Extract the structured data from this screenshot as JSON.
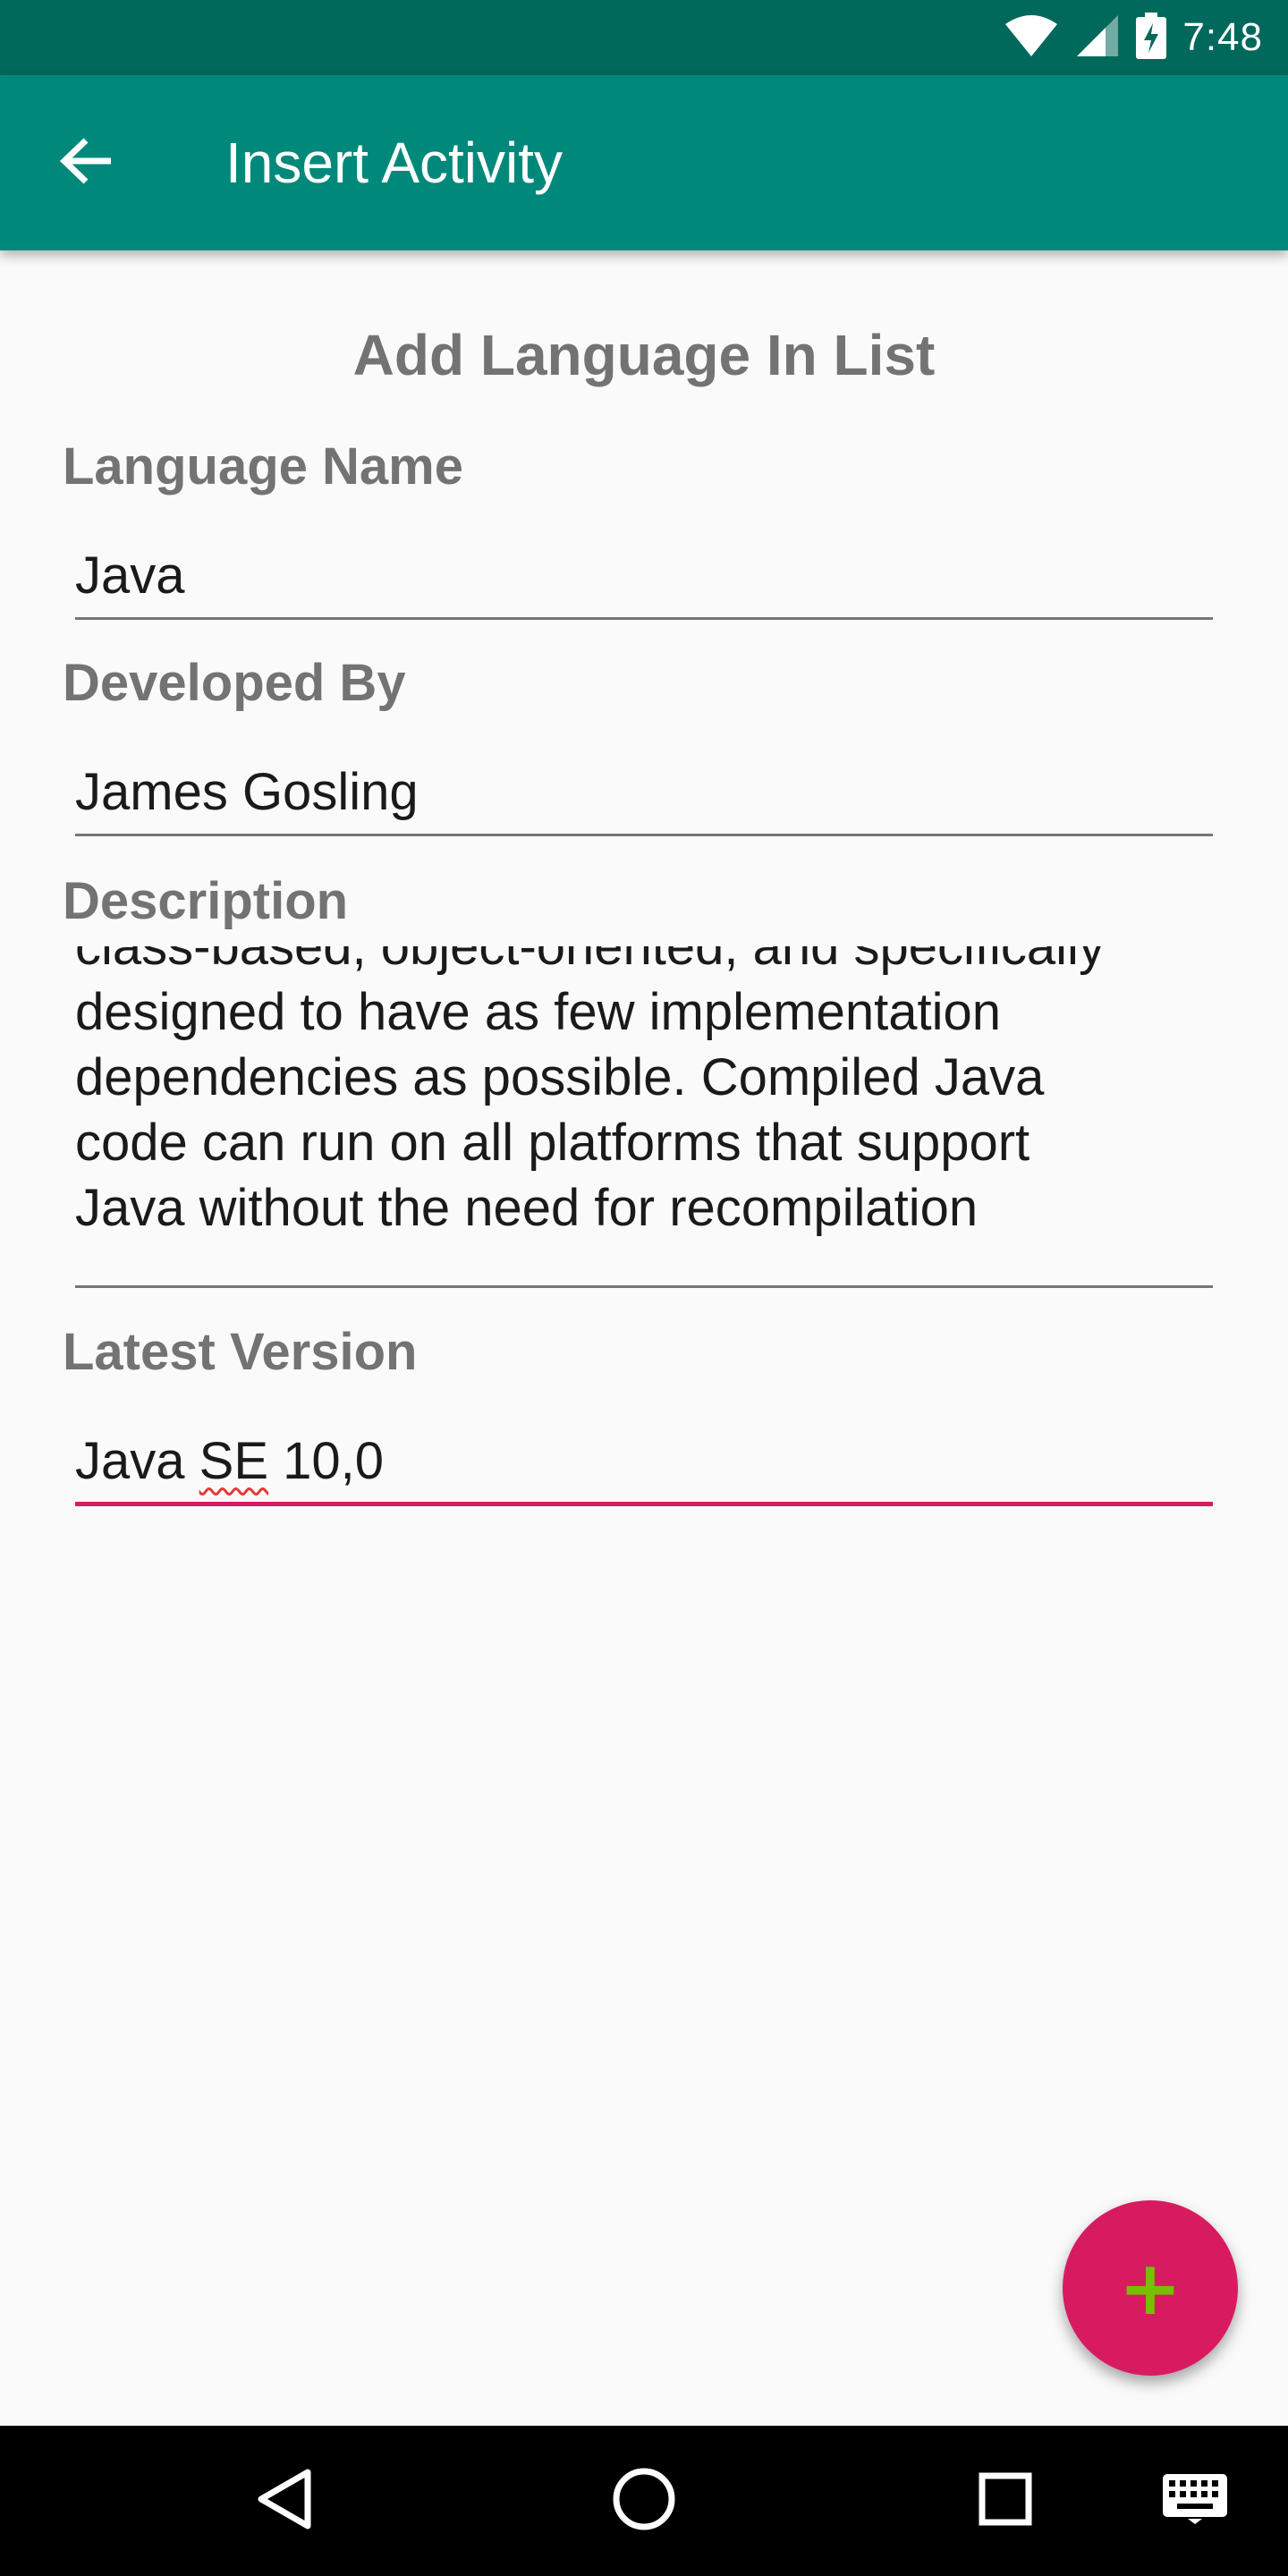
{
  "status_bar": {
    "time": "7:48",
    "icons": [
      "wifi-icon",
      "cell-signal-icon",
      "battery-charging-icon"
    ]
  },
  "app_bar": {
    "title": "Insert Activity",
    "back_icon": "arrow-left-icon",
    "background": "#00897b"
  },
  "form": {
    "heading": "Add Language In List",
    "language_name": {
      "label": "Language Name",
      "value": "Java"
    },
    "developed_by": {
      "label": "Developed By",
      "value": "James Gosling"
    },
    "description": {
      "label": "Description",
      "lines": [
        "class-based, object-oriented, and specifically",
        "designed to have as few implementation",
        "dependencies as possible. Compiled Java",
        "code can run on all platforms that support",
        "Java without the need for recompilation"
      ]
    },
    "latest_version": {
      "label": "Latest Version",
      "value_prefix": "Java ",
      "value_misspelled": "SE",
      "value_suffix": " 10,0"
    }
  },
  "fab": {
    "icon": "plus-icon",
    "color": "#d81b60"
  },
  "nav_bar": {
    "buttons": [
      "back-triangle-icon",
      "home-circle-icon",
      "recents-square-icon",
      "keyboard-icon"
    ]
  },
  "colors": {
    "status_bar": "#00695c",
    "accent": "#d81b60",
    "label_gray": "#737373"
  }
}
